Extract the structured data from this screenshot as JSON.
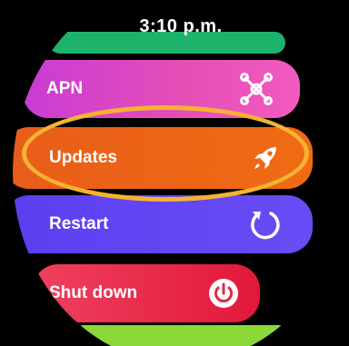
{
  "status": {
    "time": "3:10 p.m."
  },
  "menu": {
    "items": [
      {
        "label": "APN",
        "icon": "network-nodes-icon",
        "color": "#d849c8"
      },
      {
        "label": "Updates",
        "icon": "rocket-icon",
        "color": "#ee6618"
      },
      {
        "label": "Restart",
        "icon": "restart-icon",
        "color": "#5f44f2"
      },
      {
        "label": "Shut down",
        "icon": "power-icon",
        "color": "#ea2446"
      }
    ],
    "selected": "Updates",
    "highlight_color": "#f6b233"
  }
}
